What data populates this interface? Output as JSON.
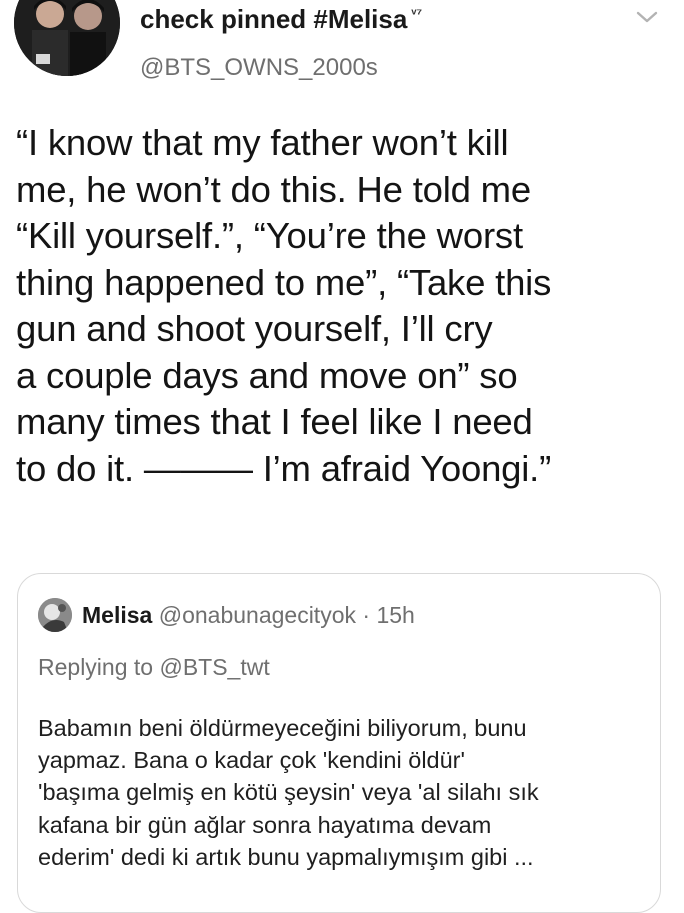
{
  "tweet": {
    "display_name": "check pinned #Melisa",
    "badge": "ᵛ⁷",
    "handle": "@BTS_OWNS_2000s",
    "menu_icon": "chevron-down-icon",
    "body": "“I know that my father won’t kill\nme, he won’t do this. He told me\n“Kill yourself.”, “You’re the worst\nthing happened to me”, “Take this\ngun and shoot yourself, I’ll cry\na couple days and move on” so\nmany times that I feel like I need\nto do it. ——— I’m afraid Yoongi.”"
  },
  "quoted_tweet": {
    "display_name": "Melisa",
    "handle": "@onabunagecityok",
    "separator": "·",
    "time": "15h",
    "replying_prefix": "Replying to",
    "replying_to": "@BTS_twt",
    "body": "Babamın beni öldürmeyeceğini biliyorum, bunu\nyapmaz. Bana o kadar çok 'kendini öldür'\n'başıma gelmiş en kötü şeysin' veya 'al silahı sık\nkafana bir gün ağlar sonra hayatıma devam\nederim' dedi ki artık bunu yapmalıymışım gibi ..."
  }
}
